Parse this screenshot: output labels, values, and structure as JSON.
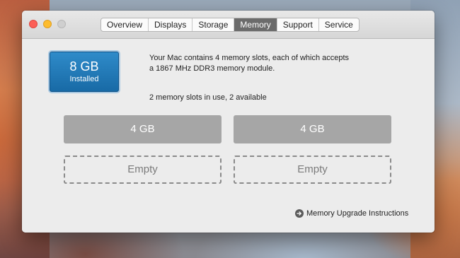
{
  "tabs": [
    {
      "label": "Overview"
    },
    {
      "label": "Displays"
    },
    {
      "label": "Storage"
    },
    {
      "label": "Memory"
    },
    {
      "label": "Support"
    },
    {
      "label": "Service"
    }
  ],
  "active_tab": "Memory",
  "installed": {
    "size": "8 GB",
    "label": "Installed"
  },
  "info": {
    "line1": "Your Mac contains 4 memory slots, each of which accepts",
    "line2": "a 1867 MHz DDR3 memory module.",
    "slots_summary": "2 memory slots in use, 2 available"
  },
  "slots": [
    {
      "label": "4 GB",
      "state": "filled"
    },
    {
      "label": "4 GB",
      "state": "filled"
    },
    {
      "label": "Empty",
      "state": "empty"
    },
    {
      "label": "Empty",
      "state": "empty"
    }
  ],
  "upgrade_link": {
    "label": "Memory Upgrade Instructions",
    "icon": "arrow-right-circle-icon"
  },
  "colors": {
    "accent": "#1f72b2",
    "active_tab": "#6b6b6b",
    "slot_filled": "#a6a6a6"
  }
}
